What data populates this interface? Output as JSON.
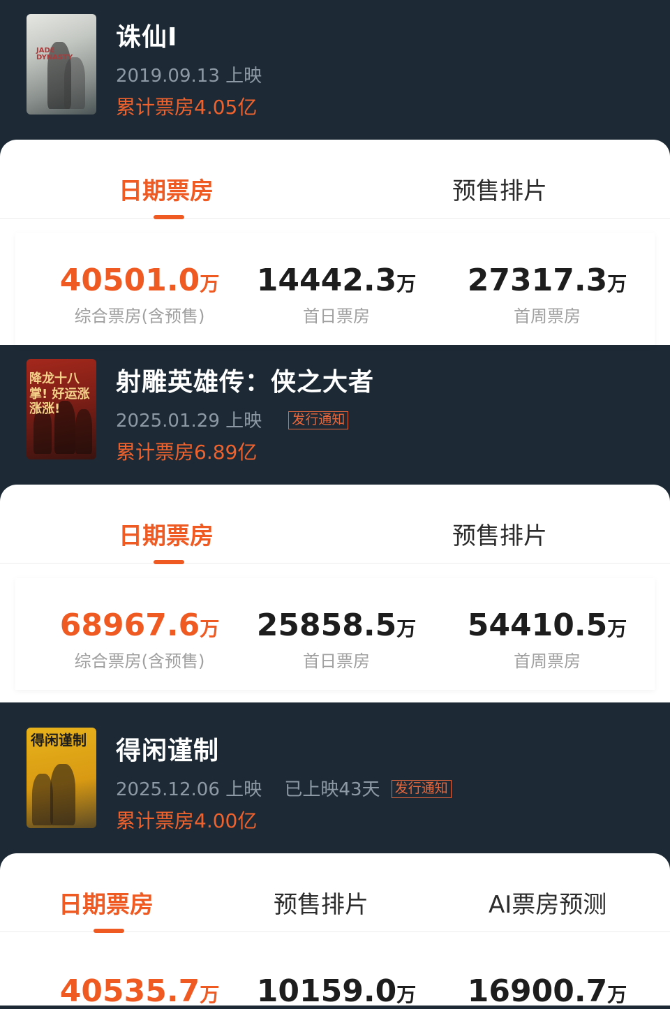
{
  "movies": [
    {
      "title": "诛仙Ⅰ",
      "release": "2019.09.13 上映",
      "tag": "",
      "days": "",
      "total": "累计票房4.05亿",
      "poster_text": "JADE DYNASTY",
      "tabs": [
        "日期票房",
        "预售排片"
      ],
      "stats": [
        {
          "value": "40501.0",
          "unit": "万",
          "label": "综合票房(含预售)"
        },
        {
          "value": "14442.3",
          "unit": "万",
          "label": "首日票房"
        },
        {
          "value": "27317.3",
          "unit": "万",
          "label": "首周票房"
        }
      ]
    },
    {
      "title": "射雕英雄传：侠之大者",
      "release": "2025.01.29 上映",
      "tag": "发行通知",
      "days": "",
      "total": "累计票房6.89亿",
      "poster_text": "降龙十八掌! 好运涨涨涨!",
      "tabs": [
        "日期票房",
        "预售排片"
      ],
      "stats": [
        {
          "value": "68967.6",
          "unit": "万",
          "label": "综合票房(含预售)"
        },
        {
          "value": "25858.5",
          "unit": "万",
          "label": "首日票房"
        },
        {
          "value": "54410.5",
          "unit": "万",
          "label": "首周票房"
        }
      ]
    },
    {
      "title": "得闲谨制",
      "release": "2025.12.06 上映",
      "tag": "发行通知",
      "days": "已上映43天",
      "total": "累计票房4.00亿",
      "poster_text": "得闲谨制",
      "tabs": [
        "日期票房",
        "预售排片",
        "AI票房预测"
      ],
      "stats": [
        {
          "value": "40535.7",
          "unit": "万",
          "label": ""
        },
        {
          "value": "10159.0",
          "unit": "万",
          "label": ""
        },
        {
          "value": "16900.7",
          "unit": "万",
          "label": ""
        }
      ]
    }
  ],
  "colors": {
    "background": "#1d2a35",
    "accent": "#ef5a23",
    "card": "#ffffff"
  },
  "icons": [
    "poster-image"
  ]
}
